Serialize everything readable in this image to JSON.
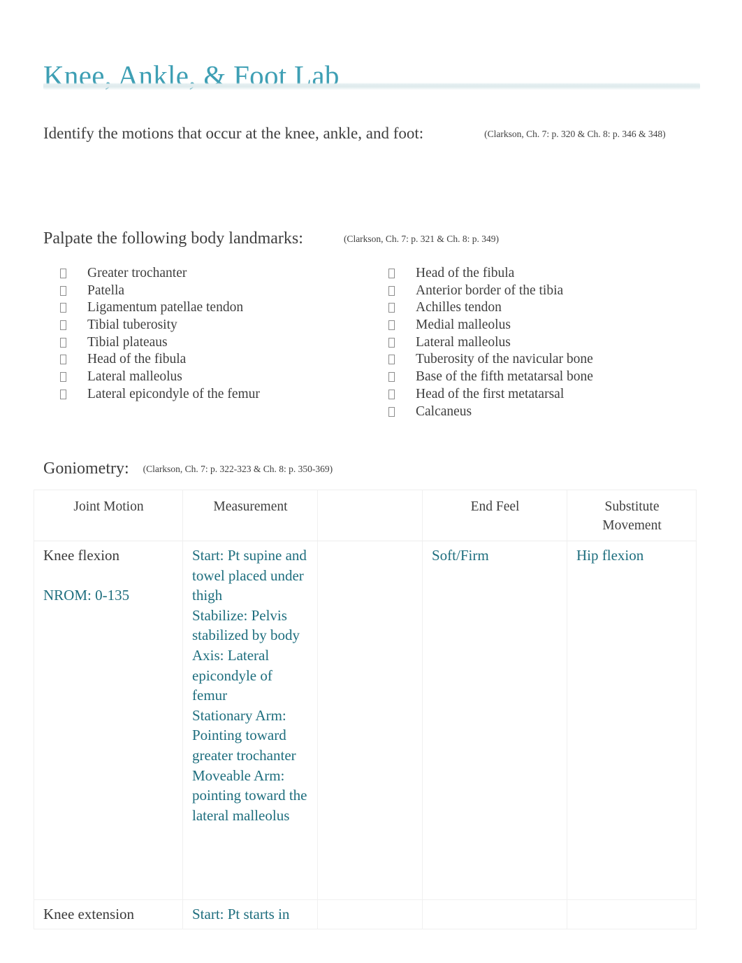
{
  "document": {
    "title": "Knee, Ankle, & Foot Lab",
    "title_color": "#3E9FB4",
    "body_accent_color": "#1E6E7E"
  },
  "sections": {
    "identify": {
      "prompt": "Identify the motions that occur at the knee, ankle, and foot:",
      "citation": "(Clarkson, Ch. 7: p. 320 & Ch. 8: p. 346 & 348)"
    },
    "palpate": {
      "prompt": "Palpate the following body landmarks:",
      "citation": "(Clarkson, Ch. 7: p. 321 & Ch. 8: p. 349)",
      "left_column": [
        "Greater trochanter",
        "Patella",
        "Ligamentum patellae tendon",
        "Tibial tuberosity",
        "Tibial plateaus",
        "Head of the fibula",
        "Lateral malleolus",
        "Lateral epicondyle of the femur"
      ],
      "right_column": [
        "Head of the fibula",
        "Anterior border of the tibia",
        "Achilles tendon",
        "Medial malleolus",
        "Lateral malleolus",
        "Tuberosity of the navicular bone",
        "Base of the fifth metatarsal bone",
        "Head of the first metatarsal",
        "Calcaneus"
      ],
      "bullet_glyph": "missing-glyph-box"
    },
    "goniometry": {
      "prompt": "Goniometry:",
      "citation": "(Clarkson, Ch. 7: p. 322-323 & Ch. 8: p. 350-369)",
      "table": {
        "headers": [
          "Joint Motion",
          "Measurement",
          "",
          "End Feel",
          "Substitute Movement"
        ],
        "rows": [
          {
            "joint_motion": "Knee flexion",
            "joint_motion_nrom": "NROM: 0-135",
            "measurement_lines": [
              "Start: Pt supine and towel placed under thigh",
              "Stabilize: Pelvis stabilized by body",
              "Axis: Lateral epicondyle of femur",
              "Stationary Arm: Pointing toward greater trochanter",
              "Moveable Arm: pointing toward the lateral malleolus"
            ],
            "blank": "",
            "end_feel": "Soft/Firm",
            "substitute_movement": "Hip flexion"
          },
          {
            "joint_motion": "Knee extension",
            "joint_motion_nrom": "",
            "measurement_lines": [
              "Start: Pt starts in"
            ],
            "blank": "",
            "end_feel": "",
            "substitute_movement": ""
          }
        ]
      }
    }
  }
}
